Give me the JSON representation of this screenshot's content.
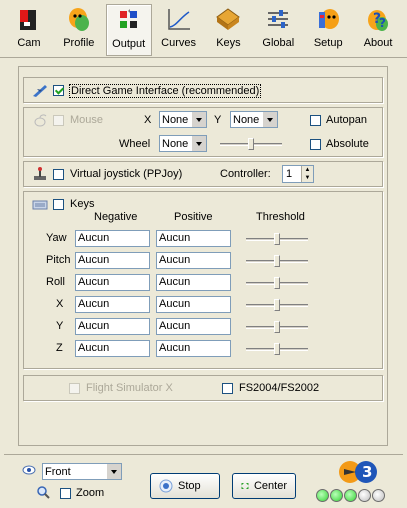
{
  "toolbar": {
    "items": [
      {
        "label": "Cam",
        "icon": "camera-icon"
      },
      {
        "label": "Profile",
        "icon": "profile-mask-icon"
      },
      {
        "label": "Output",
        "icon": "output-grid-icon",
        "active": true
      },
      {
        "label": "Curves",
        "icon": "curves-chart-icon"
      },
      {
        "label": "Keys",
        "icon": "keys-icon"
      },
      {
        "label": "Global",
        "icon": "global-sliders-icon"
      },
      {
        "label": "Setup",
        "icon": "setup-mask-icon"
      },
      {
        "label": "About",
        "icon": "about-question-icon"
      }
    ]
  },
  "dgi": {
    "label": "Direct Game Interface (recommended)",
    "checked": true
  },
  "mouse": {
    "label": "Mouse",
    "x_label": "X",
    "x_value": "None",
    "y_label": "Y",
    "y_value": "None",
    "wheel_label": "Wheel",
    "wheel_value": "None",
    "autopan_label": "Autopan",
    "absolute_label": "Absolute"
  },
  "ppjoy": {
    "label": "Virtual joystick (PPJoy)",
    "controller_label": "Controller:",
    "controller_value": "1"
  },
  "keys": {
    "label": "Keys",
    "col_negative": "Negative",
    "col_positive": "Positive",
    "col_threshold": "Threshold",
    "rows": [
      {
        "axis": "Yaw",
        "negative": "Aucun",
        "positive": "Aucun"
      },
      {
        "axis": "Pitch",
        "negative": "Aucun",
        "positive": "Aucun"
      },
      {
        "axis": "Roll",
        "negative": "Aucun",
        "positive": "Aucun"
      },
      {
        "axis": "X",
        "negative": "Aucun",
        "positive": "Aucun"
      },
      {
        "axis": "Y",
        "negative": "Aucun",
        "positive": "Aucun"
      },
      {
        "axis": "Z",
        "negative": "Aucun",
        "positive": "Aucun"
      }
    ]
  },
  "sim": {
    "fsx_label": "Flight Simulator X",
    "fs2004_label": "FS2004/FS2002"
  },
  "bottom": {
    "view_value": "Front",
    "zoom_label": "Zoom",
    "stop_label": "Stop",
    "center_label": "Center",
    "version_badge": "3"
  },
  "colors": {
    "accent": "#003c74",
    "led_green": "#35d135",
    "led_gray": "#bdbdbd"
  }
}
